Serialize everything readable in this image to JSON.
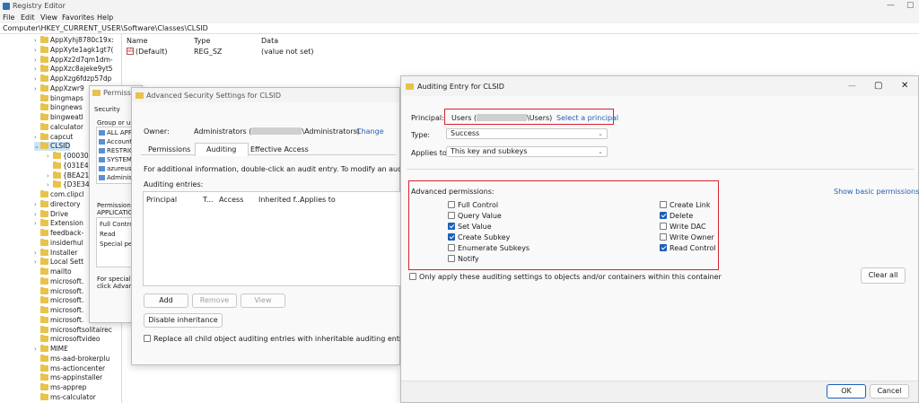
{
  "registry": {
    "title": "Registry Editor",
    "menu": [
      "File",
      "Edit",
      "View",
      "Favorites",
      "Help"
    ],
    "address": "Computer\\HKEY_CURRENT_USER\\Software\\Classes\\CLSID",
    "window_controls": [
      "—",
      "▢"
    ],
    "tree": [
      {
        "label": "AppXyhj8780c19x:",
        "indent": 1,
        "expand": true
      },
      {
        "label": "AppXyte1agk1gt7(",
        "indent": 1,
        "expand": true
      },
      {
        "label": "AppXz2d7qm1dm-",
        "indent": 1,
        "expand": true
      },
      {
        "label": "AppXzc8ajeke9yt5",
        "indent": 1,
        "expand": true
      },
      {
        "label": "AppXzg6fdzp57dp",
        "indent": 1,
        "expand": true
      },
      {
        "label": "AppXzwr9",
        "indent": 1,
        "expand": true
      },
      {
        "label": "bingmaps",
        "indent": 1,
        "expand": false
      },
      {
        "label": "bingnews",
        "indent": 1,
        "expand": false
      },
      {
        "label": "bingweatl",
        "indent": 1,
        "expand": false
      },
      {
        "label": "calculator",
        "indent": 1,
        "expand": false
      },
      {
        "label": "capcut",
        "indent": 1,
        "expand": true
      },
      {
        "label": "CLSID",
        "indent": 1,
        "expand": "open",
        "selected": true
      },
      {
        "label": "{00030",
        "indent": 2,
        "expand": true
      },
      {
        "label": "{031E4",
        "indent": 2,
        "expand": false
      },
      {
        "label": "{BEA21",
        "indent": 2,
        "expand": true
      },
      {
        "label": "{D3E34",
        "indent": 2,
        "expand": true
      },
      {
        "label": "com.clipcl",
        "indent": 1,
        "expand": false
      },
      {
        "label": "directory",
        "indent": 1,
        "expand": true
      },
      {
        "label": "Drive",
        "indent": 1,
        "expand": true
      },
      {
        "label": "Extension",
        "indent": 1,
        "expand": true
      },
      {
        "label": "feedback-",
        "indent": 1,
        "expand": false
      },
      {
        "label": "insiderhul",
        "indent": 1,
        "expand": false
      },
      {
        "label": "Installer",
        "indent": 1,
        "expand": true
      },
      {
        "label": "Local Sett",
        "indent": 1,
        "expand": true
      },
      {
        "label": "mailto",
        "indent": 1,
        "expand": false
      },
      {
        "label": "microsoft.",
        "indent": 1,
        "expand": false
      },
      {
        "label": "microsoft.",
        "indent": 1,
        "expand": false
      },
      {
        "label": "microsoft.",
        "indent": 1,
        "expand": false
      },
      {
        "label": "microsoft.",
        "indent": 1,
        "expand": false
      },
      {
        "label": "microsoft.",
        "indent": 1,
        "expand": false
      },
      {
        "label": "microsoftsolitairec",
        "indent": 1,
        "expand": false
      },
      {
        "label": "microsoftvideo",
        "indent": 1,
        "expand": false
      },
      {
        "label": "MIME",
        "indent": 1,
        "expand": true
      },
      {
        "label": "ms-aad-brokerplu",
        "indent": 1,
        "expand": false
      },
      {
        "label": "ms-actioncenter",
        "indent": 1,
        "expand": false
      },
      {
        "label": "ms-appinstaller",
        "indent": 1,
        "expand": false
      },
      {
        "label": "ms-apprep",
        "indent": 1,
        "expand": false
      },
      {
        "label": "ms-calculator",
        "indent": 1,
        "expand": false
      }
    ],
    "values_header": {
      "name": "Name",
      "type": "Type",
      "data": "Data"
    },
    "values": [
      {
        "name": "(Default)",
        "type": "REG_SZ",
        "data": "(value not set)"
      }
    ]
  },
  "permissions_dialog": {
    "title": "Permission",
    "tab": "Security",
    "group_label": "Group or use",
    "principals": [
      "ALL APP",
      "Account",
      "RESTRIC",
      "SYSTEM",
      "azureuse",
      "Administ"
    ],
    "perm_label": "Permissions",
    "perm_label2": "APPLICATIO",
    "perms": [
      "Full Contro",
      "Read",
      "Special pe"
    ],
    "special_note1": "For special p",
    "special_note2": "click Advanc"
  },
  "advanced_dialog": {
    "title": "Advanced Security Settings for CLSID",
    "owner_label": "Owner:",
    "owner_value": "Administrators (",
    "owner_value_end": "\\Administrators)",
    "owner_change": "Change",
    "tabs": [
      "Permissions",
      "Auditing",
      "Effective Access"
    ],
    "info": "For additional information, double-click an audit entry. To modify an audit entry, sel",
    "entries_label": "Auditing entries:",
    "columns": [
      "Principal",
      "T...",
      "Access",
      "Inherited f...",
      "Applies to"
    ],
    "add": "Add",
    "remove": "Remove",
    "view": "View",
    "disable_inheritance": "Disable inheritance",
    "replace_label": "Replace all child object auditing entries with inheritable auditing entries from this"
  },
  "audit_dialog": {
    "title": "Auditing Entry for CLSID",
    "principal_label": "Principal:",
    "principal_value_start": "Users (",
    "principal_value_end": "\\Users)",
    "select_principal": "Select a principal",
    "type_label": "Type:",
    "type_value": "Success",
    "applies_label": "Applies to:",
    "applies_value": "This key and subkeys",
    "adv_label": "Advanced permissions:",
    "show_basic": "Show basic permissions",
    "perms_left": [
      {
        "label": "Full Control",
        "checked": false
      },
      {
        "label": "Query Value",
        "checked": false
      },
      {
        "label": "Set Value",
        "checked": true
      },
      {
        "label": "Create Subkey",
        "checked": true
      },
      {
        "label": "Enumerate Subkeys",
        "checked": false
      },
      {
        "label": "Notify",
        "checked": false
      }
    ],
    "perms_right": [
      {
        "label": "Create Link",
        "checked": false
      },
      {
        "label": "Delete",
        "checked": true
      },
      {
        "label": "Write DAC",
        "checked": false
      },
      {
        "label": "Write Owner",
        "checked": false
      },
      {
        "label": "Read Control",
        "checked": true
      }
    ],
    "only_apply": "Only apply these auditing settings to objects and/or containers within this container",
    "clear_all": "Clear all",
    "ok": "OK",
    "cancel": "Cancel",
    "window_controls": [
      "—",
      "▢",
      "✕"
    ]
  }
}
